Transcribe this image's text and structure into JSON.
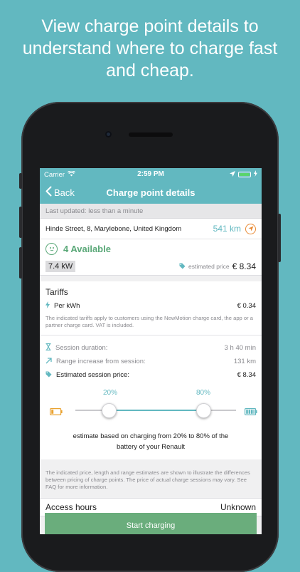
{
  "promo": {
    "line1": "View charge point details to",
    "line2": "understand where to charge fast",
    "line3": "and cheap."
  },
  "status_bar": {
    "carrier": "Carrier",
    "time": "2:59 PM"
  },
  "nav": {
    "back_label": "Back",
    "title": "Charge point details"
  },
  "last_updated": "Last updated: less than a minute",
  "location": {
    "address": "Hinde Street, 8, Marylebone, United Kingdom",
    "distance": "541 km"
  },
  "availability": {
    "text": "4 Available"
  },
  "power": {
    "kw": "7.4 kW",
    "est_label": "estimated price",
    "est_value": "€ 8.34"
  },
  "tariffs": {
    "title": "Tariffs",
    "per_kwh_label": "Per kWh",
    "per_kwh_value": "€ 0.34",
    "note": "The indicated tariffs apply to customers using the NewMotion charge card, the app or a partner charge card. VAT is included."
  },
  "session": {
    "duration_label": "Session duration:",
    "duration_value": "3 h 40 min",
    "range_label": "Range increase from session:",
    "range_value": "131 km",
    "price_label": "Estimated session price:",
    "price_value": "€ 8.34"
  },
  "slider": {
    "min_label": "20%",
    "max_label": "80%",
    "min_value": 0.2,
    "max_value": 0.8
  },
  "estimate_note": {
    "line1": "estimate based on charging from 20% to 80% of the",
    "line2": "battery of your Renault"
  },
  "disclaimer": "The indicated price, length and range estimates are shown to illustrate the differences between pricing of charge points. The price of actual charge sessions may vary. See FAQ for more information.",
  "access": {
    "label": "Access hours",
    "value": "Unknown"
  },
  "start_button": "Start charging",
  "colors": {
    "accent": "#62b8c0",
    "available": "#5aa878",
    "start_button": "#6aad7c",
    "orange": "#e98a34"
  }
}
